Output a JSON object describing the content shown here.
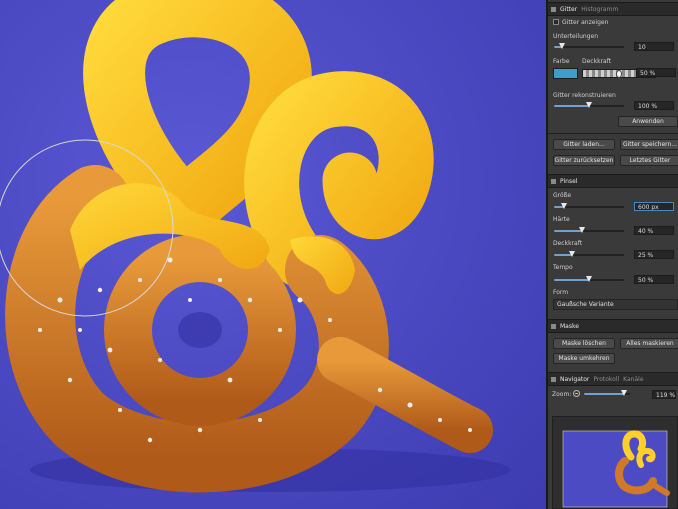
{
  "colors": {
    "canvas_bg": "#4d4bc4",
    "panel_bg": "#3a3a3a",
    "header_bg": "#2a2a2a",
    "accent": "#6fa0d8",
    "swatch": "#3aa0c8"
  },
  "grid_section": {
    "tabs": [
      "Gitter",
      "Histogramm"
    ],
    "show_grid_label": "Gitter anzeigen",
    "subdivisions_label": "Unterteilungen",
    "subdivisions_value": "10",
    "subdivisions_level": 0.12,
    "color_label": "Farbe",
    "opacity_label": "Deckkraft",
    "opacity_value": "50 %",
    "opacity_level": 0.5,
    "rebuild_label": "Gitter rekonstruieren",
    "rebuild_value": "100 %",
    "rebuild_level": 0.5,
    "apply_button": "Anwenden",
    "load_button": "Gitter laden...",
    "save_button": "Gitter speichern...",
    "reset_button": "Gitter zurücksetzen",
    "last_button": "Letztes Gitter"
  },
  "brush_section": {
    "title": "Pinsel",
    "size_label": "Größe",
    "size_value": "600 px",
    "size_level": 0.14,
    "hardness_label": "Härte",
    "hardness_value": "40 %",
    "hardness_level": 0.4,
    "opacity_label": "Deckkraft",
    "opacity_value": "25 %",
    "opacity_level": 0.25,
    "tempo_label": "Tempo",
    "tempo_value": "50 %",
    "tempo_level": 0.5,
    "form_label": "Form",
    "form_value": "Gaußsche Variante"
  },
  "mask_section": {
    "title": "Maske",
    "clear_button": "Maske löschen",
    "mask_all_button": "Alles maskieren",
    "invert_button": "Maske umkehren"
  },
  "navigator_section": {
    "tabs": [
      "Navigator",
      "Protokoll",
      "Kanäle"
    ],
    "zoom_label": "Zoom:",
    "zoom_value": "119 %",
    "zoom_level": 0.88
  }
}
